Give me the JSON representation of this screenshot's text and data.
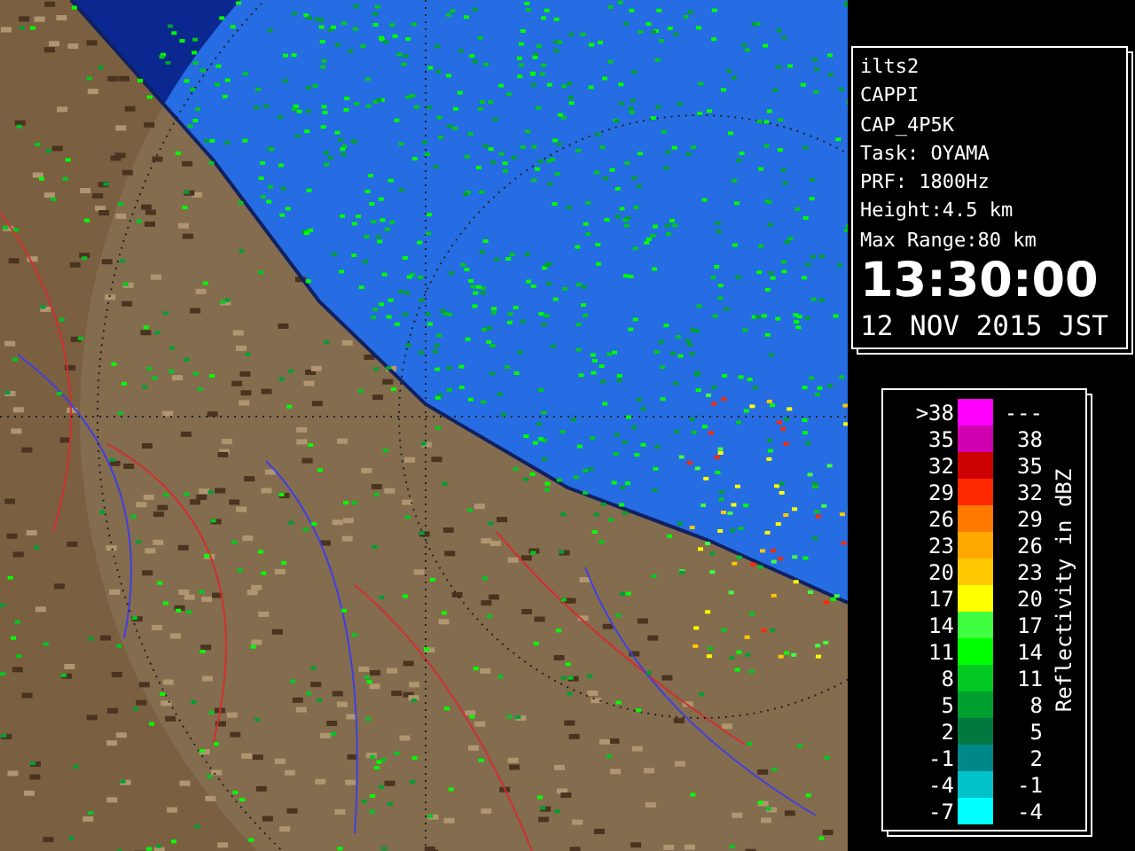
{
  "info": {
    "lines": [
      "ilts2",
      "CAPPI",
      "CAP_4P5K",
      "Task: OYAMA",
      "PRF: 1800Hz",
      "Height:4.5 km",
      "Max Range:80 km"
    ],
    "time": "13:30:00",
    "date": "12 NOV 2015 JST"
  },
  "legend": {
    "title": "Reflectivity in dBZ",
    "rows": [
      {
        "low": ">38",
        "high": "---",
        "color": "#ff00ff"
      },
      {
        "low": "35",
        "high": "38",
        "color": "#d000b0"
      },
      {
        "low": "32",
        "high": "35",
        "color": "#cc0000"
      },
      {
        "low": "29",
        "high": "32",
        "color": "#ff2800"
      },
      {
        "low": "26",
        "high": "29",
        "color": "#ff7800"
      },
      {
        "low": "23",
        "high": "26",
        "color": "#ffa800"
      },
      {
        "low": "20",
        "high": "23",
        "color": "#ffc800"
      },
      {
        "low": "17",
        "high": "20",
        "color": "#ffff00"
      },
      {
        "low": "14",
        "high": "17",
        "color": "#40ff40"
      },
      {
        "low": "11",
        "high": "14",
        "color": "#00ff00"
      },
      {
        "low": "8",
        "high": "11",
        "color": "#00c820"
      },
      {
        "low": "5",
        "high": "8",
        "color": "#00a030"
      },
      {
        "low": "2",
        "high": "5",
        "color": "#007840"
      },
      {
        "low": "-1",
        "high": "2",
        "color": "#008888"
      },
      {
        "low": "-4",
        "high": "-1",
        "color": "#00c0c8"
      },
      {
        "low": "-7",
        "high": "-4",
        "color": "#00ffff"
      }
    ]
  }
}
